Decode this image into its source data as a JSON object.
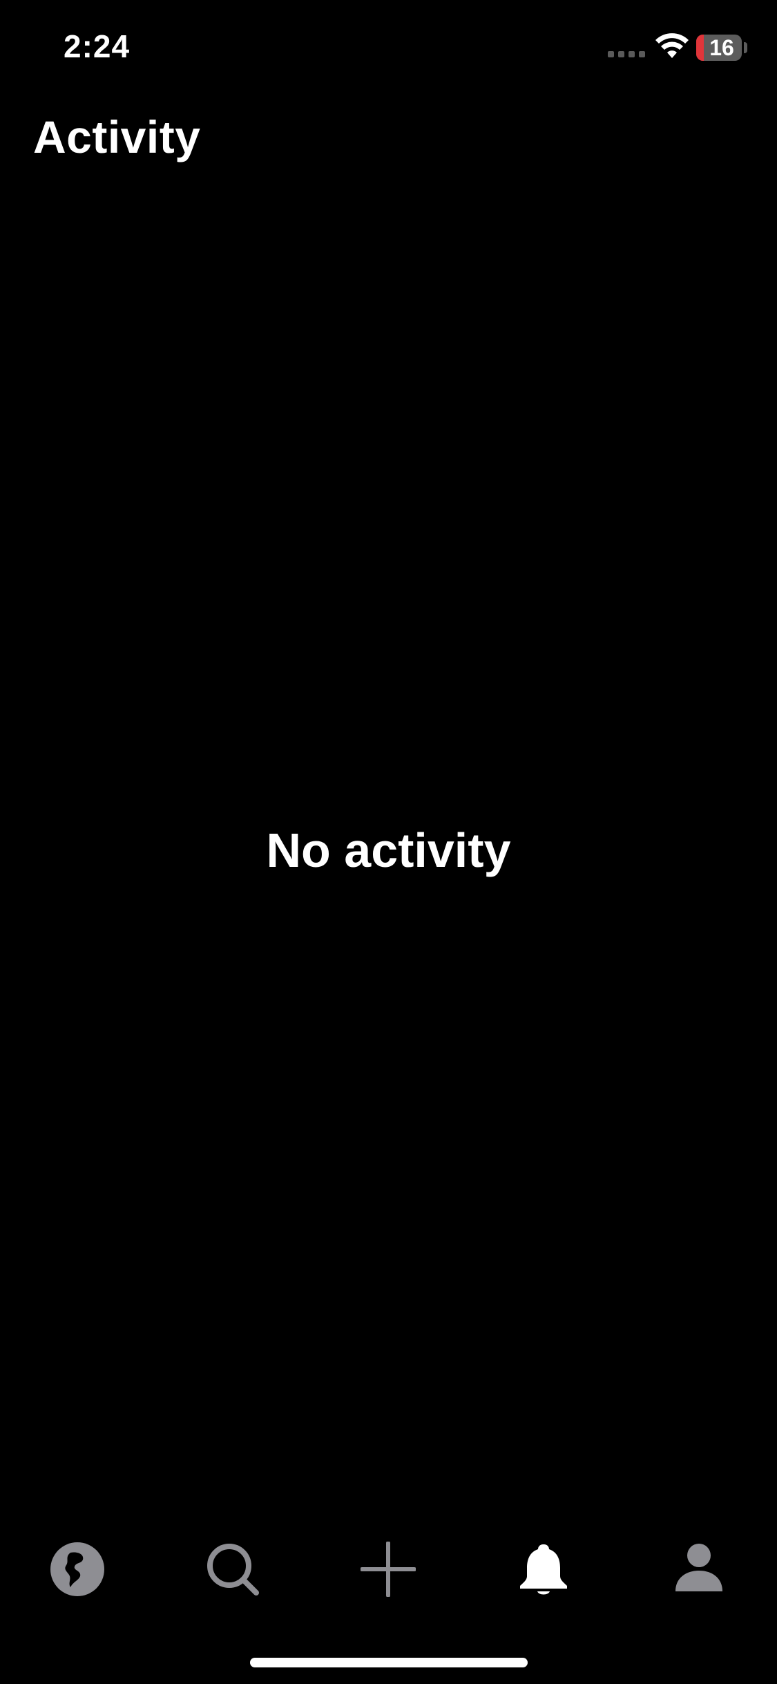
{
  "status_bar": {
    "time": "2:24",
    "battery_level": "16",
    "battery_fraction": 0.16,
    "battery_low_color": "#e0353a"
  },
  "header": {
    "title": "Activity"
  },
  "main": {
    "empty_message": "No activity"
  },
  "tab_bar": {
    "tabs": [
      {
        "name": "explore",
        "icon": "globe-icon",
        "active": false
      },
      {
        "name": "search",
        "icon": "search-icon",
        "active": false
      },
      {
        "name": "create",
        "icon": "plus-icon",
        "active": false
      },
      {
        "name": "activity",
        "icon": "bell-icon",
        "active": true
      },
      {
        "name": "profile",
        "icon": "person-icon",
        "active": false
      }
    ],
    "active_color": "#ffffff",
    "inactive_color": "#8e8e93"
  }
}
